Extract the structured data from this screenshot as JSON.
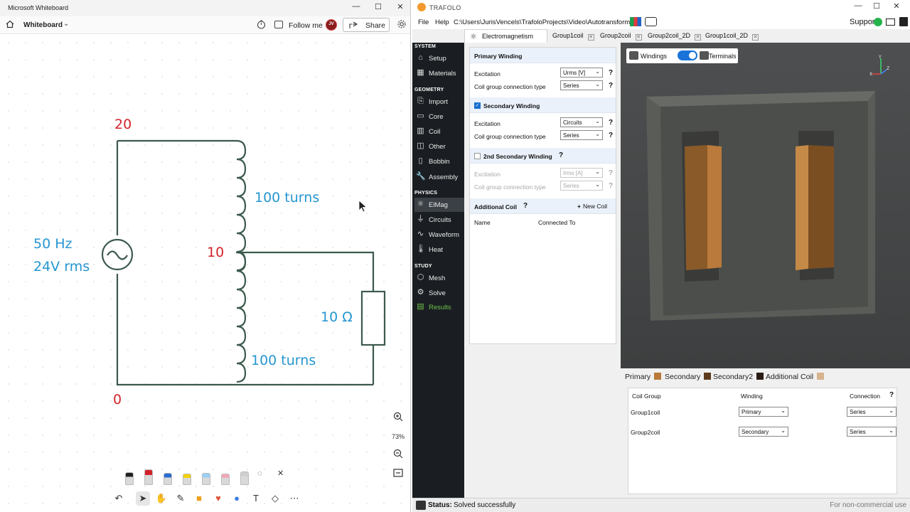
{
  "whiteboard": {
    "window_title": "Microsoft Whiteboard",
    "board_name": "Whiteboard",
    "follow_label": "Follow me",
    "avatar_initials": "JV",
    "share_label": "Share",
    "zoom_level": "73%",
    "circuit": {
      "label_top": "20",
      "label_mid": "10",
      "label_bottom": "0",
      "turns_upper": "100 turns",
      "turns_lower": "100 turns",
      "source_freq": "50 Hz",
      "source_volt": "24V rms",
      "load": "10 Ω"
    },
    "pen_colors": [
      "#222222",
      "#d2232a",
      "#2a6bd0",
      "#f2d200",
      "#9ad0f5",
      "#f2a8b8",
      "#cfcfcf"
    ]
  },
  "trafolo": {
    "app_title": "TRAFOLO",
    "menu": {
      "file": "File",
      "help": "Help",
      "path": "C:\\Users\\JurisVencels\\TrafoloProjects\\Video\\Autotransformer"
    },
    "support_label": "Support:",
    "tabs": [
      {
        "label": "Electromagnetism"
      },
      {
        "label": "Group1coil"
      },
      {
        "label": "Group2coil"
      },
      {
        "label": "Group2coil_2D"
      },
      {
        "label": "Group1coil_2D"
      }
    ],
    "sidebar": {
      "system": "SYSTEM",
      "geometry": "GEOMETRY",
      "physics": "PHYSICS",
      "study": "STUDY",
      "items": {
        "setup": "Setup",
        "materials": "Materials",
        "import": "Import",
        "core": "Core",
        "coil": "Coil",
        "other": "Other",
        "bobbin": "Bobbin",
        "assembly": "Assembly",
        "elmag": "ElMag",
        "circuits": "Circuits",
        "waveform": "Waveform",
        "heat": "Heat",
        "mesh": "Mesh",
        "solve": "Solve",
        "results": "Results"
      }
    },
    "panel": {
      "primary": {
        "title": "Primary Winding",
        "excitation_label": "Excitation",
        "excitation_value": "Urms [V]",
        "conn_label": "Coil group connection type",
        "conn_value": "Series"
      },
      "secondary": {
        "title": "Secondary Winding",
        "checked": true,
        "excitation_label": "Excitation",
        "excitation_value": "Circuits",
        "conn_label": "Coil group connection type",
        "conn_value": "Series"
      },
      "secondary2": {
        "title": "2nd Secondary Winding",
        "checked": false,
        "excitation_label": "Excitation",
        "excitation_value": "Irms [A]",
        "conn_label": "Coil group connection type",
        "conn_value": "Series"
      },
      "additional": {
        "title": "Additional Coil",
        "new_coil": "New Coil",
        "col_name": "Name",
        "col_connected": "Connected To"
      },
      "help": "?"
    },
    "viewport": {
      "windings": "Windings",
      "terminals": "Terminals",
      "toggle_on": true
    },
    "legend": [
      {
        "label": "Primary",
        "color": "#b9793a"
      },
      {
        "label": "Secondary",
        "color": "#5e3b1c"
      },
      {
        "label": "Secondary2",
        "color": "#2a1c12"
      },
      {
        "label": "Additional Coil",
        "color": "#d7b48e"
      }
    ],
    "group_table": {
      "headers": {
        "group": "Coil Group",
        "winding": "Winding",
        "connection": "Connection",
        "help": "?"
      },
      "rows": [
        {
          "group": "Group1coil",
          "winding": "Primary",
          "connection": "Series"
        },
        {
          "group": "Group2coil",
          "winding": "Secondary",
          "connection": "Series"
        }
      ]
    },
    "status": {
      "label": "Status:",
      "value": "Solved successfully",
      "license": "For non-commercial use"
    }
  }
}
